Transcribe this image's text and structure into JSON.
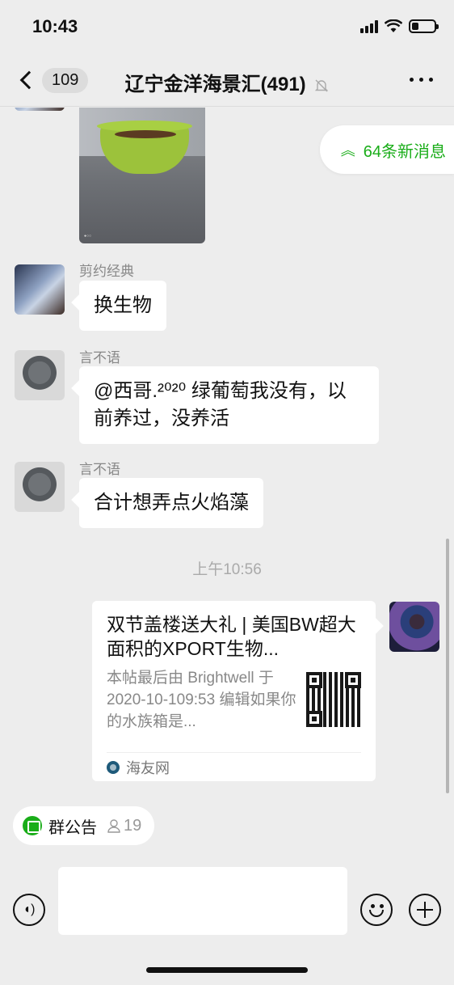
{
  "status_bar": {
    "time": "10:43",
    "battery_level": 0.3
  },
  "nav": {
    "unread_count": "109",
    "title": "辽宁金洋海景汇(491)",
    "muted": true
  },
  "new_messages": {
    "label": "64条新消息"
  },
  "messages": [
    {
      "type": "image",
      "description_icon": "photo"
    },
    {
      "sender": "剪约经典",
      "text": "换生物"
    },
    {
      "sender": "言不语",
      "text": "@西哥.²⁰²⁰ 绿葡萄我没有，以前养过，没养活"
    },
    {
      "sender": "言不语",
      "text": "合计想弄点火焰藻"
    }
  ],
  "time_divider": "上午10:56",
  "link_card": {
    "title": "双节盖楼送大礼 | 美国BW超大面积的XPORT生物...",
    "description": "本帖最后由 Brightwell 于 2020-10-109:53 编辑如果你的水族箱是...",
    "source": "海友网"
  },
  "notice": {
    "label": "群公告",
    "count": "19"
  },
  "colors": {
    "accent": "#1aad19",
    "background": "#ededed",
    "bubble": "#ffffff"
  }
}
